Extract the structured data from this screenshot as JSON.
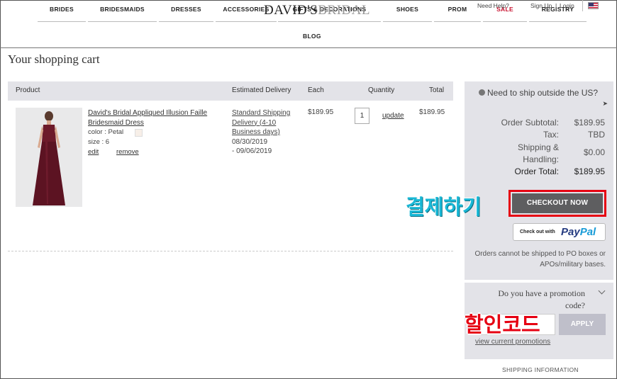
{
  "header": {
    "nav": [
      "BRIDES",
      "BRIDESMAIDS",
      "DRESSES",
      "ACCESSORIES",
      "GIFTS & DECORATIONS",
      "SHOES",
      "PROM",
      "SALE",
      "REGISTRY"
    ],
    "logo_main": "DAVID'S",
    "logo_sub": "BRIDAL",
    "need_help": "Need Help?",
    "sign_up": "Sign Up",
    "separator": "|",
    "login": "Login",
    "blog": "BLOG"
  },
  "cart": {
    "title": "Your shopping cart",
    "columns": [
      "Product",
      "Estimated Delivery",
      "Each",
      "Quantity",
      "Total"
    ],
    "item": {
      "name": "David's Bridal Appliqued Illusion Faille Bridesmaid Dress",
      "color": "color : Petal",
      "size": "size : 6",
      "edit": "edit",
      "remove": "remove",
      "delivery_link": "Standard Shipping Delivery (4-10 Business days)",
      "delivery_from": "08/30/2019",
      "delivery_to": "- 09/06/2019",
      "each": "$189.95",
      "quantity": "1",
      "update": "update",
      "total": "$189.95"
    }
  },
  "summary": {
    "ship_outside": "Need to ship outside the US?",
    "ship_arrow": "➤",
    "subtotal_label": "Order Subtotal:",
    "subtotal": "$189.95",
    "tax_label": "Tax:",
    "tax": "TBD",
    "shipping_label_1": "Shipping &",
    "shipping_label_2": "Handling:",
    "shipping": "$0.00",
    "total_label": "Order Total:",
    "total": "$189.95",
    "checkout": "CHECKOUT NOW",
    "paypal_pre": "Check out with",
    "paypal_pay": "Pay",
    "paypal_pal": "Pal",
    "po_note": "Orders cannot be shipped to PO boxes or APOs/military bases."
  },
  "promo": {
    "question_1": "Do you have a promotion",
    "question_2": "code?",
    "apply": "APPLY",
    "view": "view current promotions",
    "shipping_info": "SHIPPING INFORMATION"
  },
  "annotations": {
    "checkout_ko": "결제하기",
    "promo_ko": "할인코드"
  },
  "colors": {
    "highlight": "#e60012",
    "annotation_cyan": "#19b8d6",
    "checkout_button": "#5e5e60",
    "panel_bg": "#e3e3e8"
  }
}
